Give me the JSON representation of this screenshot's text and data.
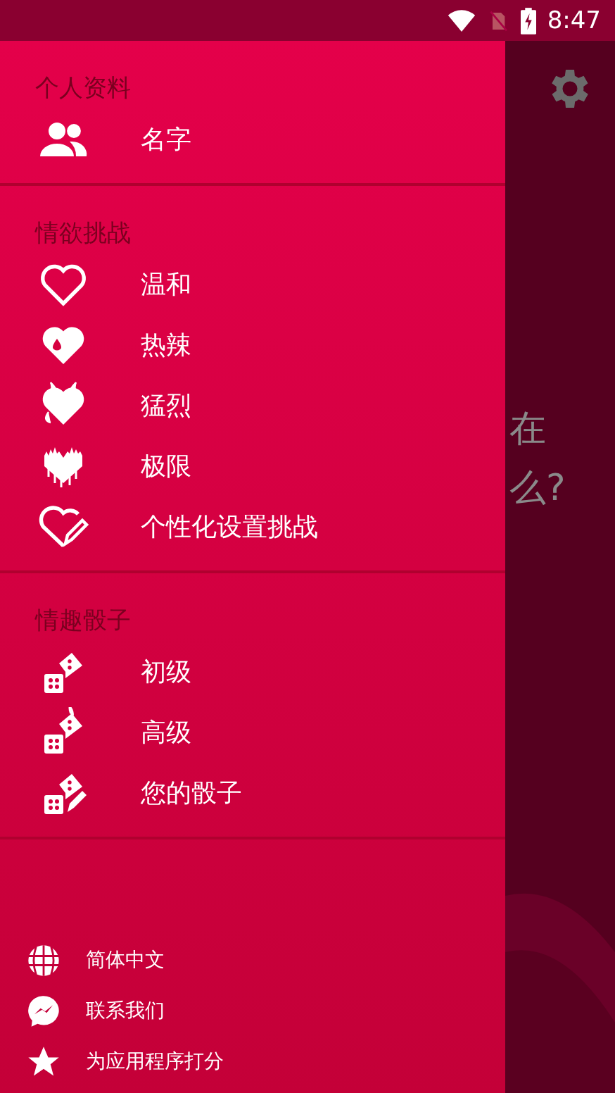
{
  "status_bar": {
    "time": "8:47"
  },
  "background_text": [
    "在",
    "么?"
  ],
  "drawer": {
    "sections": [
      {
        "title": "个人资料",
        "items": [
          {
            "label": "名字",
            "kind": "people"
          }
        ]
      },
      {
        "title": "情欲挑战",
        "items": [
          {
            "label": "温和",
            "kind": "heart-outline"
          },
          {
            "label": "热辣",
            "kind": "heart-drop"
          },
          {
            "label": "猛烈",
            "kind": "heart-devil"
          },
          {
            "label": "极限",
            "kind": "heart-spiky"
          },
          {
            "label": "个性化设置挑战",
            "kind": "heart-pencil"
          }
        ]
      },
      {
        "title": "情趣骰子",
        "items": [
          {
            "label": "初级",
            "kind": "dice"
          },
          {
            "label": "高级",
            "kind": "dice-fire"
          },
          {
            "label": "您的骰子",
            "kind": "dice-pencil"
          }
        ]
      }
    ],
    "footer": [
      {
        "label": "简体中文",
        "kind": "globe"
      },
      {
        "label": "联系我们",
        "kind": "chat"
      },
      {
        "label": "为应用程序打分",
        "kind": "star"
      }
    ]
  }
}
